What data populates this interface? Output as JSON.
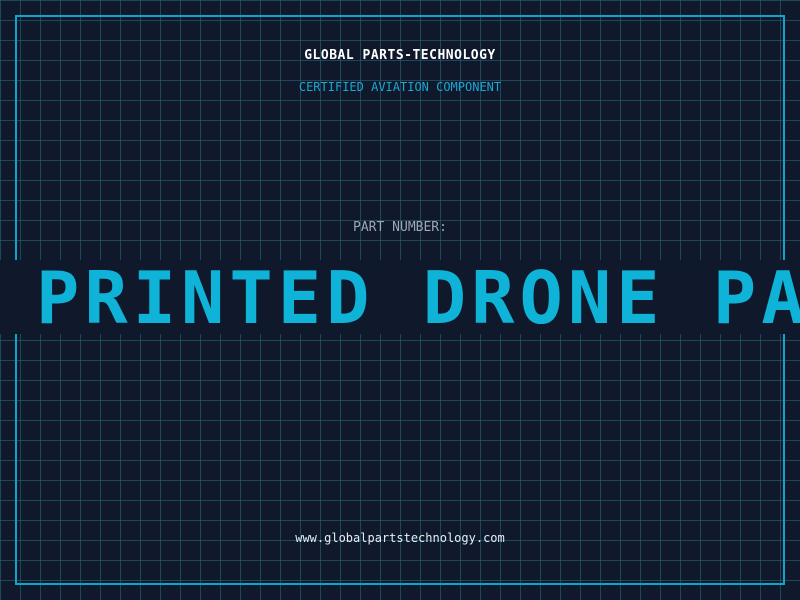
{
  "header": {
    "company": "GLOBAL PARTS-TECHNOLOGY",
    "subtitle": "CERTIFIED AVIATION COMPONENT"
  },
  "part": {
    "label": "PART NUMBER:",
    "value": "PRINTED DRONE PAR"
  },
  "footer": {
    "website": "www.globalpartstechnology.com"
  },
  "colors": {
    "background": "#0f192b",
    "grid": "#276e84",
    "accent": "#0fb3d8",
    "frame": "#12a3c8"
  }
}
